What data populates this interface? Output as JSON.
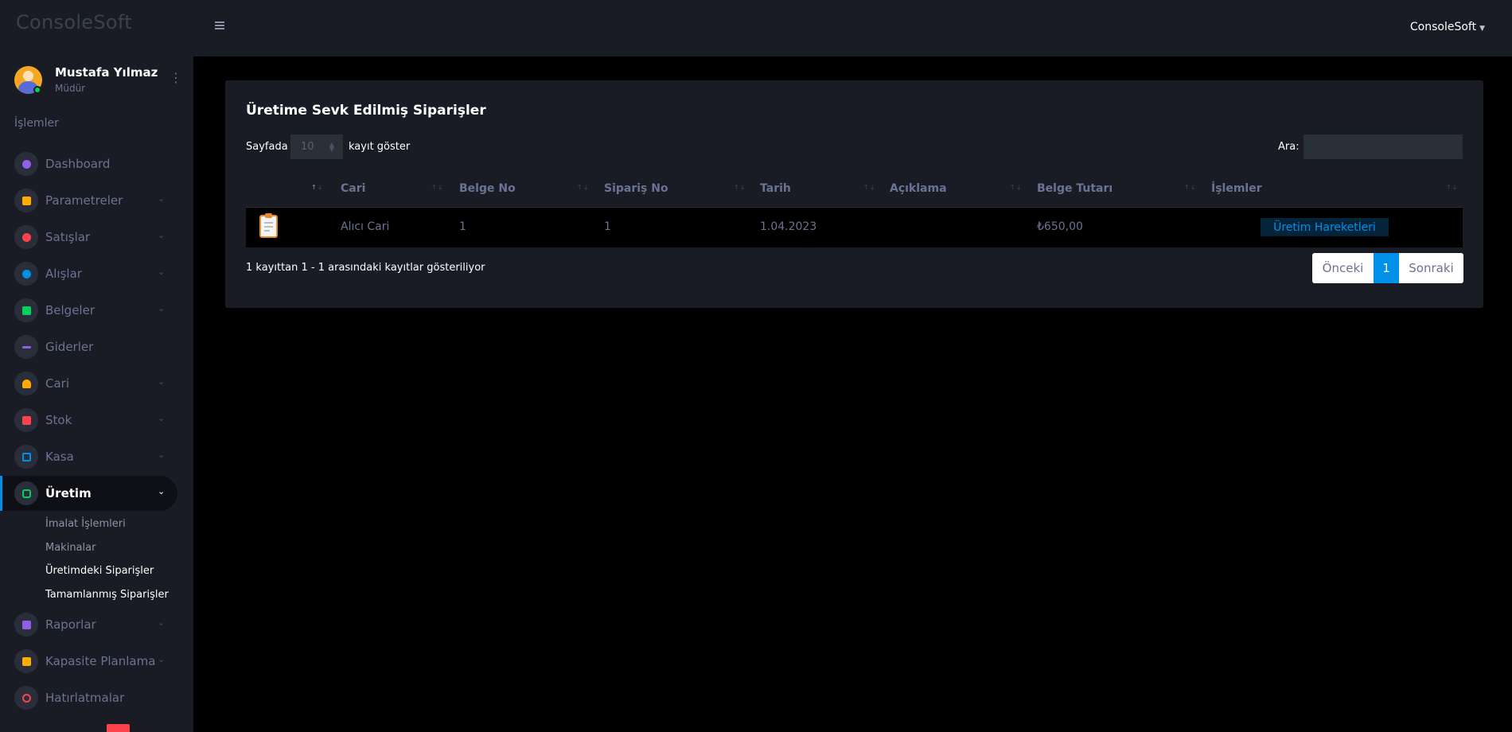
{
  "brand": "ConsoleSoft",
  "profile": {
    "name": "Mustafa Yılmaz",
    "role": "Müdür"
  },
  "sidebar": {
    "section_title": "İşlemler",
    "items": [
      {
        "label": "Dashboard",
        "icon": "speedometer-icon",
        "color": "#8f5fe8"
      },
      {
        "label": "Parametreler",
        "icon": "parameters-icon",
        "color": "#ffab00"
      },
      {
        "label": "Satışlar",
        "icon": "sales-icon",
        "color": "#fc424a"
      },
      {
        "label": "Alışlar",
        "icon": "purchases-icon",
        "color": "#0090e7"
      },
      {
        "label": "Belgeler",
        "icon": "documents-icon",
        "color": "#00d25b"
      },
      {
        "label": "Giderler",
        "icon": "expenses-icon",
        "color": "#8f5fe8"
      },
      {
        "label": "Cari",
        "icon": "accounts-icon",
        "color": "#ffab00"
      },
      {
        "label": "Stok",
        "icon": "stock-icon",
        "color": "#fc424a"
      },
      {
        "label": "Kasa",
        "icon": "cashbox-icon",
        "color": "#0090e7"
      },
      {
        "label": "Üretim",
        "icon": "production-icon",
        "color": "#00d25b"
      },
      {
        "label": "Raporlar",
        "icon": "reports-icon",
        "color": "#8f5fe8"
      },
      {
        "label": "Kapasite Planlama",
        "icon": "capacity-icon",
        "color": "#ffab00"
      },
      {
        "label": "Hatırlatmalar",
        "icon": "reminder-icon",
        "color": "#fc424a"
      }
    ],
    "production_sub": [
      "İmalat İşlemleri",
      "Makinalar",
      "Üretimdeki Siparişler",
      "Tamamlanmış Siparişler"
    ]
  },
  "topbar": {
    "user": "ConsoleSoft"
  },
  "card": {
    "title": "Üretime Sevk Edilmiş Siparişler",
    "length_label": "Sayfada",
    "length_value": "10",
    "length_suffix": "kayıt göster",
    "search_label": "Ara:",
    "search_value": "",
    "columns": [
      "",
      "Cari",
      "Belge No",
      "Sipariş No",
      "Tarih",
      "Açıklama",
      "Belge Tutarı",
      "İşlemler"
    ],
    "rows": [
      {
        "cari": "Alıcı Cari",
        "belge_no": "1",
        "siparis_no": "1",
        "tarih": "1.04.2023",
        "aciklama": "",
        "tutar": "₺650,00",
        "action": "Üretim Hareketleri"
      }
    ],
    "info": "1 kayıttan 1 - 1 arasındaki kayıtlar gösteriliyor",
    "pager": {
      "prev": "Önceki",
      "current": "1",
      "next": "Sonraki"
    }
  }
}
